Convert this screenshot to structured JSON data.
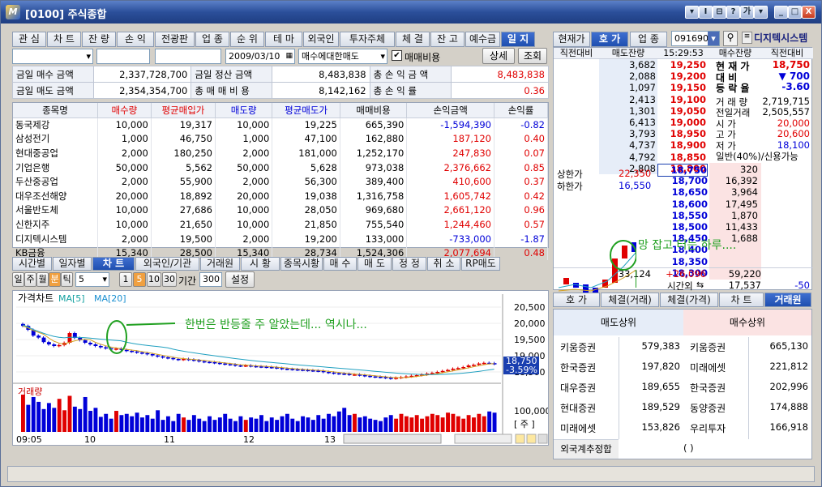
{
  "window": {
    "title": "[0100] 주식종합",
    "title_buttons": [
      "▾",
      "I",
      "⊟",
      "?",
      "가",
      "▾",
      "_",
      "□",
      "X"
    ]
  },
  "top_tabs": [
    "관 심",
    "차 트",
    "잔 량",
    "손 익",
    "전광판",
    "업 종",
    "순 위",
    "테 마",
    "외국인",
    "투자주체",
    "체 결",
    "잔 고",
    "예수금",
    "일 지"
  ],
  "account": {
    "number": "",
    "name": "",
    "date": "2009/03/10",
    "select": "매수에대한매도",
    "checkbox_label": "매매비용",
    "detail_btn": "상세",
    "query_btn": "조회"
  },
  "summary": [
    {
      "l1": "금일 매수 금액",
      "v1": "2,337,728,700",
      "l2": "금일 정산 금액",
      "v2": "8,483,838",
      "l3": "총 손 익 금 액",
      "v3": "8,483,838"
    },
    {
      "l1": "금일 매도 금액",
      "v1": "2,354,354,700",
      "l2": "총 매 매 비 용",
      "v2": "8,142,162",
      "l3": "총 손 익 률",
      "v3": "0.36"
    }
  ],
  "grid_headers": [
    "종목명",
    "매수량",
    "평균매입가",
    "매도량",
    "평균매도가",
    "매매비용",
    "손익금액",
    "손익률"
  ],
  "grid_rows": [
    [
      "동국제강",
      "10,000",
      "19,317",
      "10,000",
      "19,225",
      "665,390",
      "-1,594,390",
      "-0.82"
    ],
    [
      "삼성전기",
      "1,000",
      "46,750",
      "1,000",
      "47,100",
      "162,880",
      "187,120",
      "0.40"
    ],
    [
      "현대중공업",
      "2,000",
      "180,250",
      "2,000",
      "181,000",
      "1,252,170",
      "247,830",
      "0.07"
    ],
    [
      "기업은행",
      "50,000",
      "5,562",
      "50,000",
      "5,628",
      "973,038",
      "2,376,662",
      "0.85"
    ],
    [
      "두산중공업",
      "2,000",
      "55,900",
      "2,000",
      "56,300",
      "389,400",
      "410,600",
      "0.37"
    ],
    [
      "대우조선해양",
      "20,000",
      "18,892",
      "20,000",
      "19,038",
      "1,316,758",
      "1,605,742",
      "0.42"
    ],
    [
      "서울반도체",
      "10,000",
      "27,686",
      "10,000",
      "28,050",
      "969,680",
      "2,661,120",
      "0.96"
    ],
    [
      "신한지주",
      "10,000",
      "21,650",
      "10,000",
      "21,850",
      "755,540",
      "1,244,460",
      "0.57"
    ],
    [
      "디지텍시스템",
      "2,000",
      "19,500",
      "2,000",
      "19,200",
      "133,000",
      "-733,000",
      "-1.87"
    ],
    [
      "KB금융",
      "15,340",
      "28,500",
      "15,340",
      "28,734",
      "1,524,306",
      "2,077,694",
      "0.48"
    ]
  ],
  "chart_tabs": [
    "시간별",
    "일자별",
    "차 트",
    "외국인/기관",
    "거래원",
    "시 황",
    "종목시황",
    "매 수",
    "매 도",
    "정 정",
    "취 소",
    "RP매도"
  ],
  "chart_toolbar": {
    "periods": [
      "일",
      "주",
      "월",
      "분",
      "틱"
    ],
    "interval": "5",
    "mins": [
      "1",
      "5",
      "10",
      "30"
    ],
    "period_label": "기간",
    "period_value": "300",
    "settings": "설정"
  },
  "chart_data": {
    "type": "candlestick",
    "title": "가격차트",
    "ma_labels": [
      "MA[5]",
      "MA[20]"
    ],
    "yaxis": [
      "20,500",
      "20,000",
      "19,500",
      "19,000",
      "18,500"
    ],
    "xaxis": [
      "09:05",
      "10",
      "11",
      "12",
      "13",
      "14",
      "15"
    ],
    "price_badge": "18,750",
    "change_badge": "-3.59%",
    "volume_title": "거래량",
    "volume_axis": "100,000",
    "volume_unit": "[ 주 ]",
    "annotation": "한번은 반등줄 주 알았는데... 역시나...",
    "candles": [
      19920,
      19800,
      19620,
      19560,
      19420,
      19350,
      19300,
      19330,
      19400,
      19700,
      19550,
      19480,
      19400,
      19350,
      19300,
      19260,
      19230,
      19200,
      19220,
      19180,
      19150,
      19130,
      19100,
      19080,
      19050,
      19010,
      18980,
      18950,
      18930,
      18900,
      18880,
      18900,
      18880,
      18860,
      18830,
      18810,
      18800,
      18780,
      18760,
      18740,
      18730,
      18700,
      18690,
      18700,
      18680,
      18670,
      18660,
      18650,
      18640,
      18620,
      18600,
      18590,
      18580,
      18570,
      18560,
      18550,
      18540,
      18530,
      18500,
      18480,
      18460,
      18450,
      18440,
      18420,
      18420,
      18400,
      18380,
      18360,
      18350,
      18340,
      18320,
      18300,
      18320,
      18340,
      18360,
      18380,
      18400,
      18420,
      18450,
      18470,
      18500,
      18530,
      18560,
      18600,
      18620,
      18650,
      18700,
      18720,
      18760,
      18780,
      18770,
      18750
    ],
    "volumes": [
      62,
      45,
      58,
      50,
      38,
      48,
      40,
      55,
      36,
      60,
      42,
      38,
      58,
      35,
      40,
      25,
      30,
      22,
      35,
      28,
      30,
      26,
      32,
      24,
      28,
      22,
      36,
      20,
      26,
      18,
      30,
      24,
      20,
      28,
      22,
      18,
      26,
      20,
      24,
      30,
      22,
      18,
      26,
      20,
      24,
      22,
      28,
      18,
      24,
      20,
      26,
      30,
      22,
      18,
      26,
      24,
      20,
      28,
      22,
      30,
      26,
      34,
      40,
      28,
      30,
      24,
      26,
      22,
      20,
      18,
      24,
      28,
      22,
      30,
      26,
      24,
      28,
      22,
      26,
      30,
      28,
      24,
      32,
      30,
      26,
      22,
      28,
      24,
      30,
      26,
      34,
      32
    ]
  },
  "quote_tabs": [
    "현재가",
    "호 가",
    "업 종"
  ],
  "stock": {
    "code": "091690",
    "name": "디지텍시스템"
  },
  "orderbook": {
    "headers": [
      "직전대비",
      "매도잔량",
      "15:29:53",
      "매수잔량",
      "직전대비"
    ],
    "asks": [
      [
        "3,682",
        "19,250"
      ],
      [
        "2,088",
        "19,200"
      ],
      [
        "1,097",
        "19,150"
      ],
      [
        "2,413",
        "19,100"
      ],
      [
        "1,301",
        "19,050"
      ],
      [
        "6,413",
        "19,000"
      ],
      [
        "3,793",
        "18,950"
      ],
      [
        "4,737",
        "18,900"
      ],
      [
        "4,792",
        "18,850"
      ],
      [
        "2,808",
        "18,800"
      ]
    ],
    "bids": [
      [
        "18,750",
        "320"
      ],
      [
        "18,700",
        "16,392"
      ],
      [
        "18,650",
        "3,964"
      ],
      [
        "18,600",
        "17,495"
      ],
      [
        "18,550",
        "1,870"
      ],
      [
        "18,500",
        "11,433"
      ],
      [
        "18,450",
        "1,688"
      ],
      [
        "18,400",
        ""
      ],
      [
        "18,350",
        ""
      ],
      [
        "18,300",
        ""
      ]
    ],
    "upper_label": "상한가",
    "upper": "22,350",
    "lower_label": "하한가",
    "lower": "16,550",
    "total_ask": "33,124",
    "total_diff": "+26,096",
    "total_bid": "59,220",
    "after_label": "시간외",
    "after_value": "17,537",
    "after_diff": "-50",
    "annotation": "망 잡고 터는 하루....",
    "info": [
      [
        "현 재 가",
        "18,750"
      ],
      [
        "대 비",
        "▼ 700"
      ],
      [
        "등 락 율",
        "-3.60"
      ],
      [
        "거 래 량",
        "2,719,715"
      ],
      [
        "전일거래",
        "2,505,557"
      ],
      [
        "시 가",
        "20,000"
      ],
      [
        "고 가",
        "20,600"
      ],
      [
        "저 가",
        "18,100"
      ],
      [
        "일반(40%)/신용가능",
        ""
      ]
    ]
  },
  "bottom_tabs": [
    "호 가",
    "체결(거래)",
    "체결(가격)",
    "차 트",
    "거래원"
  ],
  "broker": {
    "sell_header": "매도상위",
    "buy_header": "매수상위",
    "rows": [
      [
        "키움증권",
        "579,383",
        "키움증권",
        "665,130"
      ],
      [
        "한국증권",
        "197,820",
        "미래에셋",
        "221,812"
      ],
      [
        "대우증권",
        "189,655",
        "한국증권",
        "202,996"
      ],
      [
        "현대증권",
        "189,529",
        "동양증권",
        "174,888"
      ],
      [
        "미래에셋",
        "153,826",
        "우리투자",
        "166,918"
      ]
    ],
    "foreign_label": "외국계추정합",
    "foreign_value": "(          )"
  },
  "colors": {
    "accent": "#1f4fb0",
    "up": "#e00000",
    "down": "#0000d8"
  }
}
